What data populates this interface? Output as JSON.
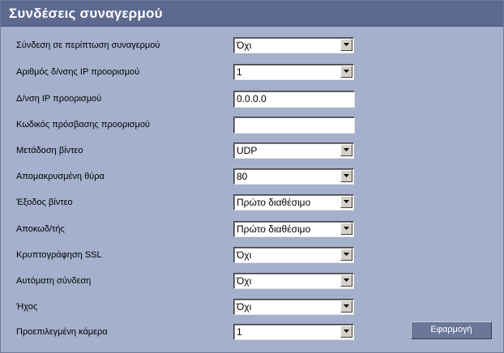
{
  "header": {
    "title": "Συνδέσεις συναγερμού"
  },
  "fields": [
    {
      "label": "Σύνδεση σε περίπτωση συναγερμού",
      "type": "select",
      "value": "Όχι"
    },
    {
      "label": "Αριθμός δ/νσης IP προορισμού",
      "type": "select",
      "value": "1"
    },
    {
      "label": "Δ/νση IP προορισμού",
      "type": "text",
      "value": "0.0.0.0"
    },
    {
      "label": "Κωδικός πρόσβασης προορισμού",
      "type": "text",
      "value": ""
    },
    {
      "label": "Μετάδοση βίντεο",
      "type": "select",
      "value": "UDP"
    },
    {
      "label": "Απομακρυσμένη θύρα",
      "type": "select",
      "value": "80"
    },
    {
      "label": "Έξοδος βίντεο",
      "type": "select",
      "value": "Πρώτο διαθέσιμο"
    },
    {
      "label": "Αποκωδ/τής",
      "type": "select",
      "value": "Πρώτο διαθέσιμο"
    },
    {
      "label": "Κρυπτογράφηση SSL",
      "type": "select",
      "value": "Όχι"
    },
    {
      "label": "Αυτόματη σύνδεση",
      "type": "select",
      "value": "Όχι"
    },
    {
      "label": "Ήχος",
      "type": "select",
      "value": "Όχι"
    },
    {
      "label": "Προεπιλεγμένη κάμερα",
      "type": "select",
      "value": "1"
    }
  ],
  "apply_button": {
    "label": "Εφαρμογή"
  },
  "icons": {
    "dropdown": "chevron-down-icon"
  },
  "colors": {
    "background": "#a5b0cc",
    "header": "#5d6a90",
    "button": "#6b7799"
  }
}
